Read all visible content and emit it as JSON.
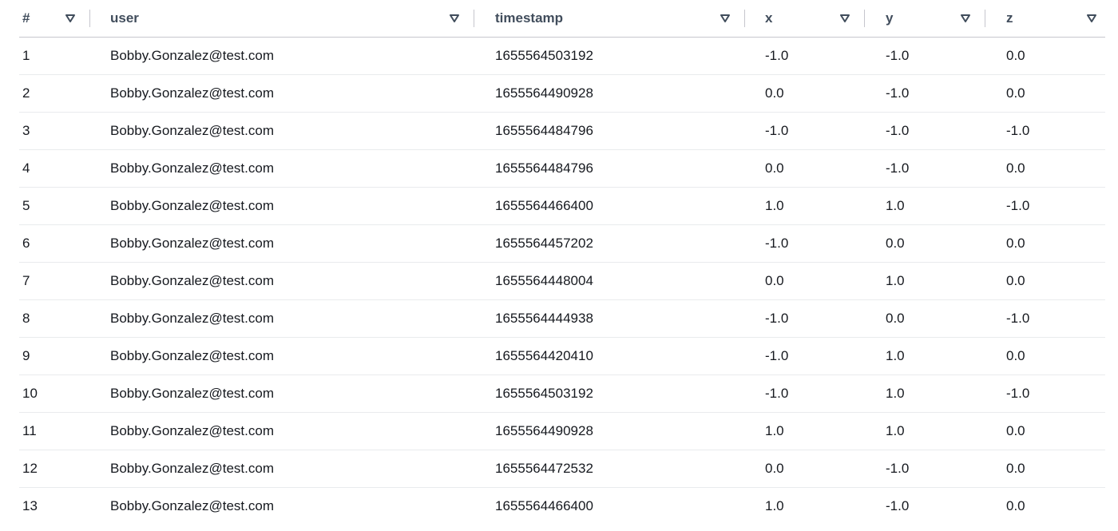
{
  "table": {
    "columns": [
      {
        "key": "idx",
        "label": "#"
      },
      {
        "key": "user",
        "label": "user"
      },
      {
        "key": "timestamp",
        "label": "timestamp"
      },
      {
        "key": "x",
        "label": "x"
      },
      {
        "key": "y",
        "label": "y"
      },
      {
        "key": "z",
        "label": "z"
      }
    ],
    "sort_icon": "filter-triangle-icon",
    "rows": [
      [
        "1",
        "Bobby.Gonzalez@test.com",
        "1655564503192",
        "-1.0",
        "-1.0",
        "0.0"
      ],
      [
        "2",
        "Bobby.Gonzalez@test.com",
        "1655564490928",
        "0.0",
        "-1.0",
        "0.0"
      ],
      [
        "3",
        "Bobby.Gonzalez@test.com",
        "1655564484796",
        "-1.0",
        "-1.0",
        "-1.0"
      ],
      [
        "4",
        "Bobby.Gonzalez@test.com",
        "1655564484796",
        "0.0",
        "-1.0",
        "0.0"
      ],
      [
        "5",
        "Bobby.Gonzalez@test.com",
        "1655564466400",
        "1.0",
        "1.0",
        "-1.0"
      ],
      [
        "6",
        "Bobby.Gonzalez@test.com",
        "1655564457202",
        "-1.0",
        "0.0",
        "0.0"
      ],
      [
        "7",
        "Bobby.Gonzalez@test.com",
        "1655564448004",
        "0.0",
        "1.0",
        "0.0"
      ],
      [
        "8",
        "Bobby.Gonzalez@test.com",
        "1655564444938",
        "-1.0",
        "0.0",
        "-1.0"
      ],
      [
        "9",
        "Bobby.Gonzalez@test.com",
        "1655564420410",
        "-1.0",
        "1.0",
        "0.0"
      ],
      [
        "10",
        "Bobby.Gonzalez@test.com",
        "1655564503192",
        "-1.0",
        "1.0",
        "-1.0"
      ],
      [
        "11",
        "Bobby.Gonzalez@test.com",
        "1655564490928",
        "1.0",
        "1.0",
        "0.0"
      ],
      [
        "12",
        "Bobby.Gonzalez@test.com",
        "1655564472532",
        "0.0",
        "-1.0",
        "0.0"
      ],
      [
        "13",
        "Bobby.Gonzalez@test.com",
        "1655564466400",
        "1.0",
        "-1.0",
        "0.0"
      ]
    ]
  }
}
